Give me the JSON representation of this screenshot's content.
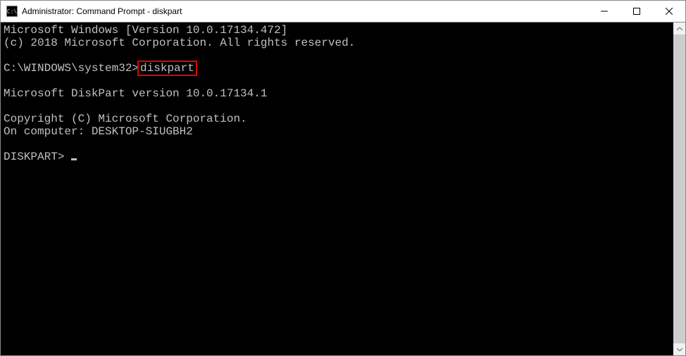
{
  "window": {
    "icon_label": "C:\\",
    "title": "Administrator: Command Prompt - diskpart"
  },
  "terminal": {
    "line1": "Microsoft Windows [Version 10.0.17134.472]",
    "line2": "(c) 2018 Microsoft Corporation. All rights reserved.",
    "blank1": "",
    "prompt_path": "C:\\WINDOWS\\system32>",
    "hl_cmd": "diskpart",
    "blank2": "",
    "line3": "Microsoft DiskPart version 10.0.17134.1",
    "blank3": "",
    "line4": "Copyright (C) Microsoft Corporation.",
    "line5": "On computer: DESKTOP-SIUGBH2",
    "blank4": "",
    "dp_prompt": "DISKPART> "
  }
}
